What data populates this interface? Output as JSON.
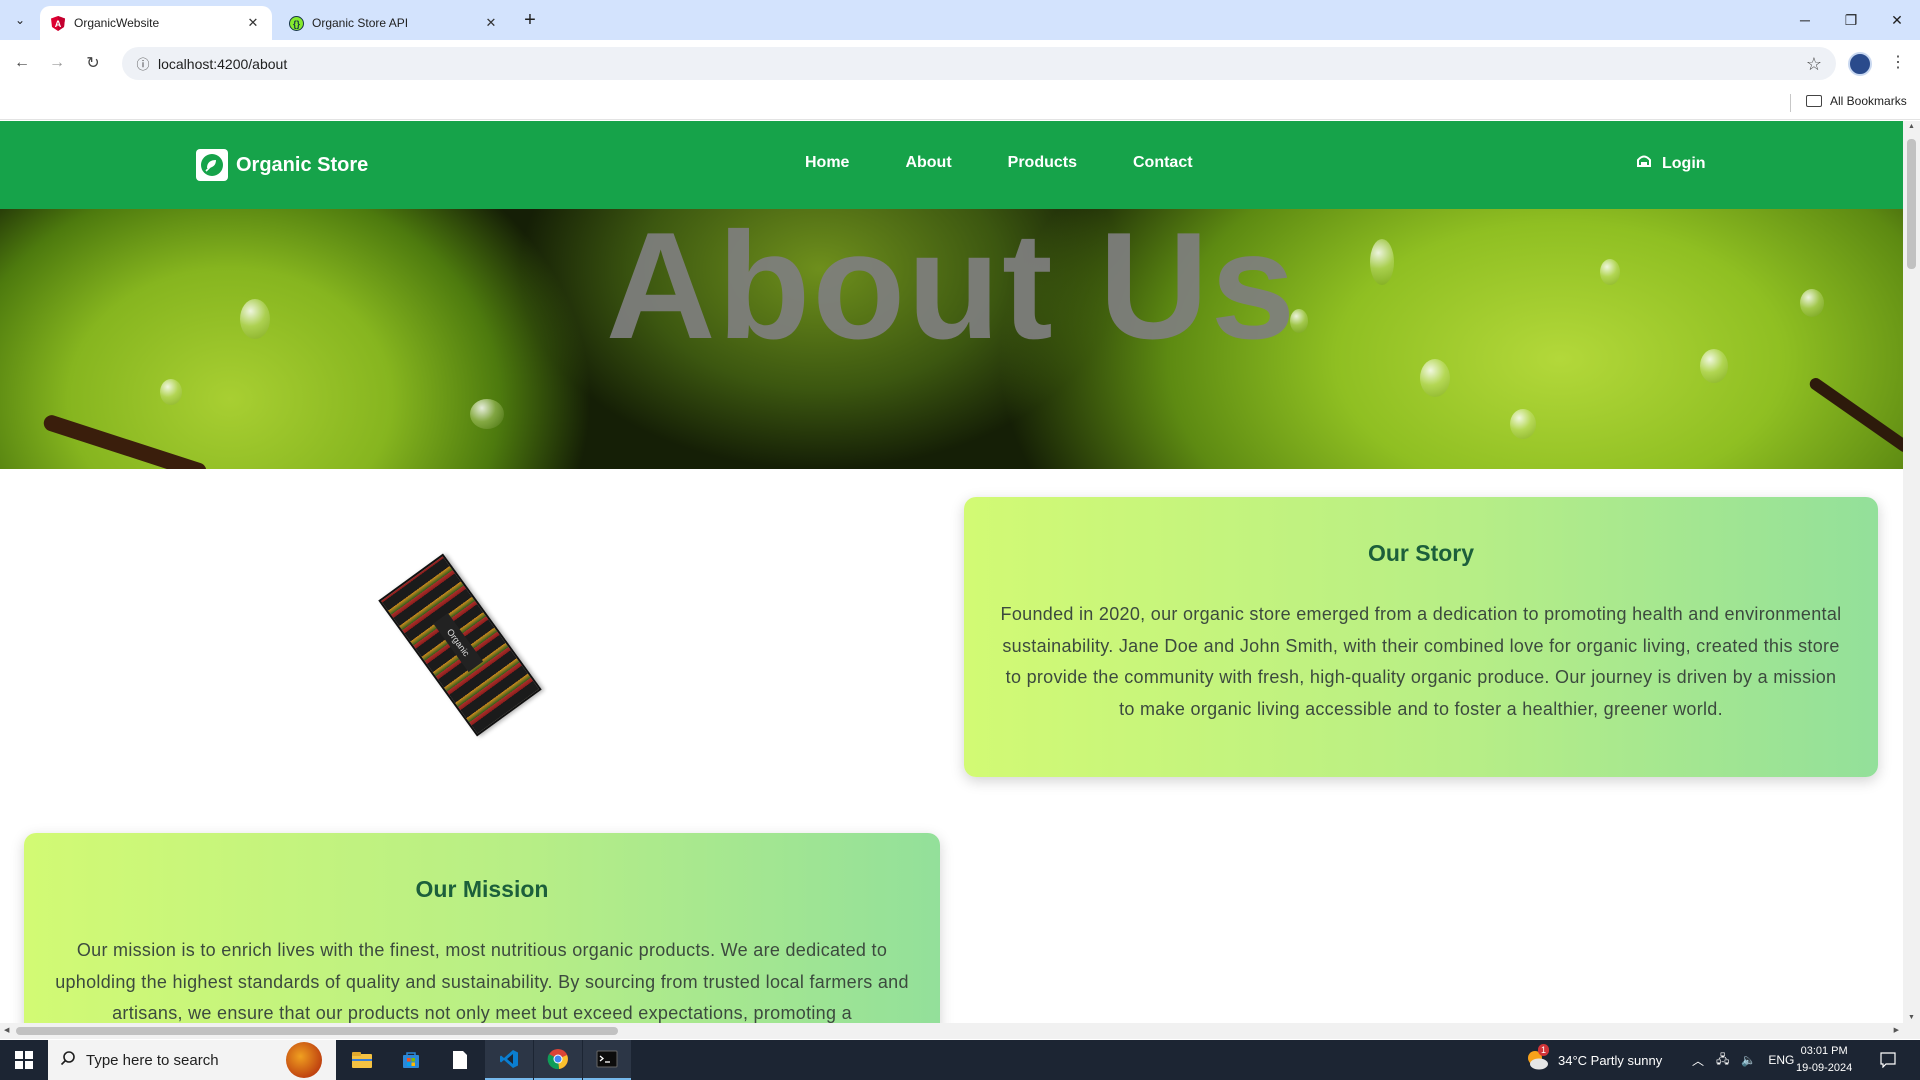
{
  "browser": {
    "tabs": [
      {
        "title": "OrganicWebsite",
        "active": true,
        "favicon": "angular-icon"
      },
      {
        "title": "Organic Store API",
        "active": false,
        "favicon": "swagger-icon"
      }
    ],
    "url": "localhost:4200/about",
    "bookmarks_label": "All Bookmarks"
  },
  "site": {
    "brand": "Organic Store",
    "nav": [
      "Home",
      "About",
      "Products",
      "Contact"
    ],
    "login": "Login",
    "hero_title": "About Us",
    "banner_label": "Organic"
  },
  "story": {
    "title": "Our Story",
    "text": "Founded in 2020, our organic store emerged from a dedication to promoting health and environmental sustainability. Jane Doe and John Smith, with their combined love for organic living, created this store to provide the community with fresh, high-quality organic produce. Our journey is driven by a mission to make organic living accessible and to foster a healthier, greener world."
  },
  "mission": {
    "title": "Our Mission",
    "text": "Our mission is to enrich lives with the finest, most nutritious organic products. We are dedicated to upholding the highest standards of quality and sustainability. By sourcing from trusted local farmers and artisans, we ensure that our products not only meet but exceed expectations, promoting a"
  },
  "taskbar": {
    "search_placeholder": "Type here to search",
    "weather": "34°C  Partly sunny",
    "language": "ENG",
    "time": "03:01 PM",
    "date": "19-09-2024",
    "weather_badge": "1"
  },
  "colors": {
    "nav_green": "#16a34a",
    "card_title": "#1c5f3b",
    "card_gradient_start": "#d2fa74",
    "card_gradient_end": "#93e09a"
  }
}
